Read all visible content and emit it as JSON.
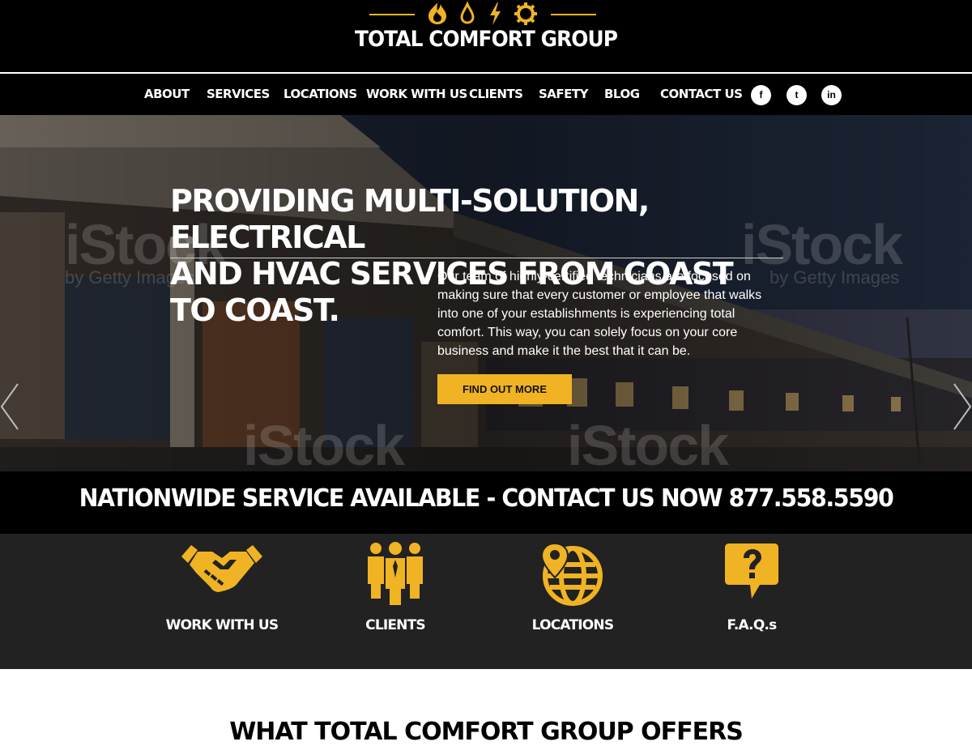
{
  "brand": {
    "name": "TOTAL COMFORT GROUP",
    "accent_color": "#f0b323",
    "logo_icons": [
      "flame-icon",
      "drop-icon",
      "bolt-icon",
      "gear-icon"
    ]
  },
  "nav": {
    "items": [
      {
        "label": "ABOUT"
      },
      {
        "label": "SERVICES"
      },
      {
        "label": "LOCATIONS"
      },
      {
        "label": "WORK WITH US"
      },
      {
        "label": "CLIENTS"
      },
      {
        "label": "SAFETY"
      },
      {
        "label": "BLOG"
      },
      {
        "label": "CONTACT US"
      }
    ],
    "social": [
      {
        "icon": "facebook-icon",
        "glyph": "f"
      },
      {
        "icon": "twitter-icon",
        "glyph": "t"
      },
      {
        "icon": "linkedin-icon",
        "glyph": "in"
      }
    ]
  },
  "hero": {
    "title_line1": "PROVIDING MULTI-SOLUTION, ELECTRICAL",
    "title_line2": "AND HVAC SERVICES FROM COAST TO COAST.",
    "body": "Our team of highly-certified technicians are focused on making sure that every customer or employee that walks into one of your establishments is experiencing total comfort. This way, you can solely focus on your core business and make it the best that it can be.",
    "cta_label": "FIND OUT MORE",
    "watermark": "iStock",
    "watermark_sub": "by Getty Images"
  },
  "banner": {
    "text": "NATIONWIDE SERVICE AVAILABLE - CONTACT US NOW 877.558.5590"
  },
  "features": [
    {
      "icon": "handshake-icon",
      "label": "WORK WITH US"
    },
    {
      "icon": "people-icon",
      "label": "CLIENTS"
    },
    {
      "icon": "globe-pin-icon",
      "label": "LOCATIONS"
    },
    {
      "icon": "question-bubble-icon",
      "label": "F.A.Q.s"
    }
  ],
  "offers": {
    "title": "WHAT TOTAL COMFORT GROUP OFFERS"
  }
}
